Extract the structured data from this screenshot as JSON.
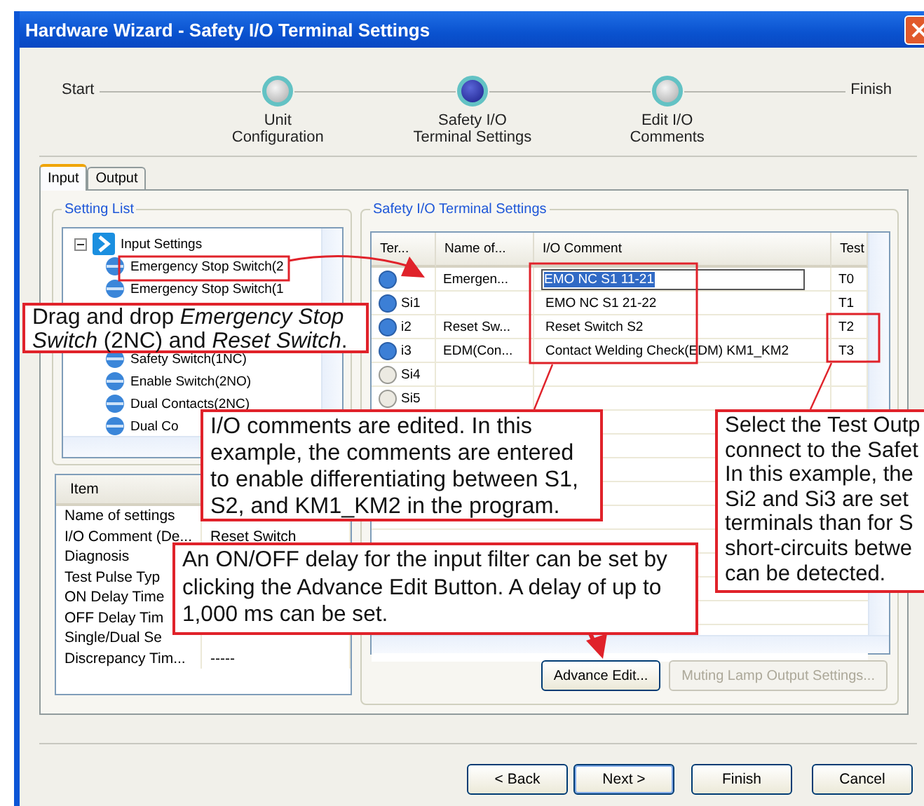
{
  "window": {
    "title": "Hardware Wizard - Safety I/O Terminal Settings"
  },
  "wizard": {
    "start": "Start",
    "finish": "Finish",
    "steps": [
      {
        "label": "Unit\nConfiguration",
        "current": false
      },
      {
        "label": "Safety I/O\nTerminal Settings",
        "current": true
      },
      {
        "label": "Edit I/O\nComments",
        "current": false
      }
    ]
  },
  "tabs": [
    {
      "label": "Input",
      "selected": true
    },
    {
      "label": "Output",
      "selected": false
    }
  ],
  "setting_list": {
    "title": "Setting List",
    "root": {
      "label": "Input Settings",
      "expanded": true,
      "children": [
        {
          "label": "Emergency Stop Switch(2"
        },
        {
          "label": "Emergency Stop Switch(1"
        },
        {
          "label": "Safety Switch(1NC)"
        },
        {
          "label": "Enable Switch(2NO)"
        },
        {
          "label": "Dual Contacts(2NC)"
        },
        {
          "label": "Dual Co"
        }
      ]
    }
  },
  "properties": {
    "columns": [
      "Item"
    ],
    "rows": [
      {
        "item": "Name of settings"
      },
      {
        "item": "I/O Comment (De...",
        "value": "Reset Switch"
      },
      {
        "item": "Diagnosis"
      },
      {
        "item": "Test Pulse Typ"
      },
      {
        "item": "ON Delay Time"
      },
      {
        "item": "OFF Delay Tim"
      },
      {
        "item": "Single/Dual Se"
      },
      {
        "item": "Discrepancy Tim...",
        "value": "-----"
      }
    ]
  },
  "terminal_settings": {
    "title": "Safety I/O Terminal Settings",
    "columns": [
      "Ter...",
      "Name of...",
      "I/O Comment",
      "Test"
    ],
    "rows": [
      {
        "name": "Emergen...",
        "comment": "EMO NC S1 11-21",
        "test": "T0",
        "assigned": true,
        "editing": true
      },
      {
        "terminal": "Si1",
        "comment": "EMO NC S1 21-22",
        "test": "T1",
        "assigned": true,
        "editing": false
      },
      {
        "terminal": "i2",
        "name": "Reset Sw...",
        "comment": "Reset Switch S2",
        "test": "T2",
        "assigned": true,
        "editing": false
      },
      {
        "terminal": "i3",
        "name": "EDM(Con...",
        "comment": "Contact Welding Check(EDM) KM1_KM2",
        "test": "T3",
        "assigned": true,
        "editing": false
      },
      {
        "terminal": "Si4",
        "assigned": false,
        "editing": false
      },
      {
        "terminal": "Si5",
        "assigned": false,
        "editing": false
      }
    ],
    "buttons": [
      {
        "label": "Advance Edit...",
        "disabled": false
      },
      {
        "label": "Muting Lamp Output Settings...",
        "disabled": true
      }
    ]
  },
  "nav_buttons": [
    {
      "label": "< Back",
      "default": false
    },
    {
      "label": "Next >",
      "default": true
    },
    {
      "label": "Finish",
      "default": false
    },
    {
      "label": "Cancel",
      "default": false
    }
  ],
  "callouts": [
    {
      "text": "Drag and drop *Emergency Stop Switch* (2NC) and *Reset Switch*."
    },
    {
      "text": "I/O comments are edited. In this example, the comments are entered to enable differentiating between S1, S2, and KM1_KM2 in the program."
    },
    {
      "text": "Select the Test Outp\nconnect to the Safet\nIn this example, the\nSi2 and Si3 are set\nterminals than for S\nshort-circuits betwe\ncan be detected."
    },
    {
      "text": "An ON/OFF delay for the input filter can be set by clicking the Advance Edit Button. A delay of up to 1,000 ms can be set."
    }
  ]
}
